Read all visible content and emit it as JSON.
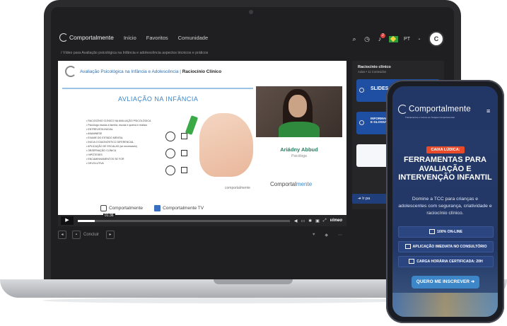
{
  "laptop": {
    "nav": {
      "logo": "Comportalmente",
      "items": [
        "Início",
        "Favoritos",
        "Comunidade"
      ],
      "notification_count": "2",
      "language": "PT",
      "avatar_letter": "C"
    },
    "breadcrumb": "/ Vídeo para Avaliação psicológica na Infância e adolescência aspectos técnicos e práticos",
    "video": {
      "slide_title_prefix": "Avaliação Psicológica na Infância e Adolescência | ",
      "slide_title_bold": "Raciocínio Clínico",
      "slide_heading": "AVLIAÇÃO NA INFÂNCIA",
      "bullets": [
        "• RACIOCÍNIO CLÍNICO NA AVALIAÇÃO PSICOLÓGICA",
        "• Psicólogo escuta a família, escola e queixa e realiza:",
        "• ENTREVISTA INICIAL",
        "• ANAMNESE",
        "• EXAME DO ESTADO MENTAL",
        "• INICIA O DIAGNÓSTICO DIFERENCIAL",
        "• APLICAÇÃO DE ESCALAS (se necessário)",
        "• OBSERVAÇÃO CLÍNICA",
        "• HIPÓTESES",
        "• ENCAMINHAMENTOS SE FOR",
        "• DEVOLUTIVA"
      ],
      "watermark": "comportalmente",
      "presenter_name": "Ariádny Abbud",
      "presenter_role": "Psicóloga",
      "brand_left": "Comportal",
      "brand_right": "mente",
      "social_instagram": "Comportalmente",
      "social_youtube": "Comportalmente TV",
      "timestamp": "01:36",
      "progress": 0.08,
      "player_brand": "vimeo"
    },
    "below": {
      "complete_label": "Concluir"
    },
    "side": {
      "title": "Raciocínio clínico",
      "subtitle": "Aulas • 11 Conteúdos",
      "cards": [
        {
          "label": "SLIDES"
        },
        {
          "label": "INFORMAÇÕES DE APOIO E GLOSSÁRIO"
        },
        {
          "label": ""
        }
      ],
      "next_label": "Ir pa"
    }
  },
  "phone": {
    "logo": "Comportalmente",
    "tagline": "Treinamentos e Cursos em Terapia Comportamental",
    "pill": "CAIXA LÚDICA:",
    "headline": "FERRAMENTAS PARA AVALIAÇÃO E INTERVENÇÃO INFANTIL",
    "description": "Domine a TCC para crianças e adolescentes com segurança, criatividade e raciocínio clínico.",
    "features": [
      "100% ON-LINE",
      "APLICAÇÃO IMEDIATA NO CONSULTÓRIO",
      "CARGA HORÁRIA CERTIFICADA: 20H"
    ],
    "cta": "QUERO ME INSCREVER"
  },
  "colors": {
    "accent_blue": "#3a86c8",
    "phone_bg": "#273b6a",
    "pill_orange": "#e84a2a",
    "card_blue": "#1f4fa3"
  }
}
